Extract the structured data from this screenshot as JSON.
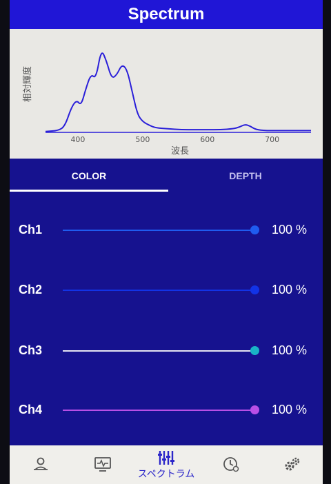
{
  "header": {
    "title": "Spectrum"
  },
  "chart_data": {
    "type": "line",
    "title": "",
    "xlabel": "波長",
    "ylabel": "相対輝度",
    "x_ticks": [
      400,
      500,
      600,
      700
    ],
    "xlim": [
      350,
      760
    ],
    "ylim": [
      0,
      1
    ],
    "grid": false,
    "line_color": "#2a1fd9",
    "series": [
      {
        "x": [
          350,
          370,
          380,
          390,
          398,
          405,
          412,
          420,
          428,
          436,
          444,
          452,
          460,
          468,
          476,
          484,
          492,
          500,
          510,
          520,
          540,
          560,
          580,
          600,
          620,
          640,
          650,
          658,
          666,
          675,
          690,
          710,
          730,
          760
        ],
        "values": [
          0.01,
          0.02,
          0.07,
          0.28,
          0.36,
          0.3,
          0.48,
          0.65,
          0.6,
          0.93,
          0.8,
          0.6,
          0.64,
          0.76,
          0.7,
          0.45,
          0.2,
          0.12,
          0.08,
          0.05,
          0.04,
          0.03,
          0.03,
          0.03,
          0.03,
          0.04,
          0.06,
          0.09,
          0.07,
          0.03,
          0.02,
          0.02,
          0.02,
          0.02
        ]
      }
    ]
  },
  "tabs": [
    {
      "label": "COLOR",
      "active": true
    },
    {
      "label": "DEPTH",
      "active": false
    }
  ],
  "channels": [
    {
      "label": "Ch1",
      "value": 100,
      "value_text": "100 %",
      "color": "#1f5cf0"
    },
    {
      "label": "Ch2",
      "value": 100,
      "value_text": "100 %",
      "color": "#1233e6"
    },
    {
      "label": "Ch3",
      "value": 100,
      "value_text": "100 %",
      "color": "#e6e6f2",
      "thumb_color": "#19b3c6"
    },
    {
      "label": "Ch4",
      "value": 100,
      "value_text": "100 %",
      "color": "#b84fe6"
    }
  ],
  "nav": {
    "items": [
      {
        "icon": "user-icon",
        "label": ""
      },
      {
        "icon": "monitor-icon",
        "label": ""
      },
      {
        "icon": "sliders-icon",
        "label": "スペクトラム",
        "active": true
      },
      {
        "icon": "timer-icon",
        "label": ""
      },
      {
        "icon": "gears-icon",
        "label": ""
      }
    ],
    "accent": "#2b26c9"
  }
}
